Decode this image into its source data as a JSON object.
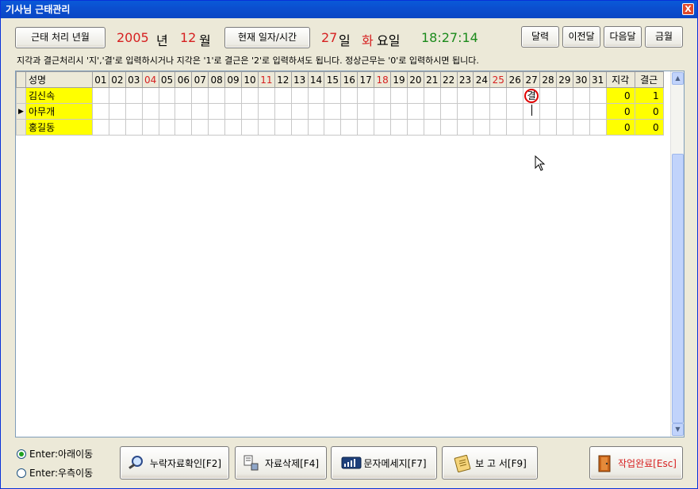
{
  "window": {
    "title": "기사님 근태관리",
    "close_glyph": "X"
  },
  "toolbar": {
    "period_button": "근태 처리 년월",
    "year": "2005",
    "year_unit": "년",
    "month": "12",
    "month_unit": "월",
    "now_button": "현재 일자/시간",
    "day": "27",
    "day_unit": "일",
    "weekday": "화",
    "weekday_unit": "요일",
    "time": "18:27:14",
    "calendar_button": "달력",
    "prev_month_button": "이전달",
    "next_month_button": "다음달",
    "this_month_button": "금월"
  },
  "instruction": "지각과 결근처리시 '지','결'로 입력하시거나 지각은 '1'로 결근은 '2'로 입력하셔도 됩니다.  정상근무는 '0'로 입력하시면 됩니다.",
  "grid": {
    "name_header": "성명",
    "day_headers": [
      "01",
      "02",
      "03",
      "04",
      "05",
      "06",
      "07",
      "08",
      "09",
      "10",
      "11",
      "12",
      "13",
      "14",
      "15",
      "16",
      "17",
      "18",
      "19",
      "20",
      "21",
      "22",
      "23",
      "24",
      "25",
      "26",
      "27",
      "28",
      "29",
      "30",
      "31"
    ],
    "red_days": [
      "04",
      "11",
      "18",
      "25"
    ],
    "late_header": "지각",
    "absent_header": "결근",
    "rows": [
      {
        "name": "김신속",
        "late": "0",
        "absent": "1",
        "marks": {
          "27": "결"
        },
        "current": false
      },
      {
        "name": "아무개",
        "late": "0",
        "absent": "0",
        "marks": {},
        "current": true
      },
      {
        "name": "홍길동",
        "late": "0",
        "absent": "0",
        "marks": {},
        "current": false
      }
    ]
  },
  "options": {
    "enter_down": "Enter:아래이동",
    "enter_right": "Enter:우측이동",
    "selected": "enter_down"
  },
  "footer": {
    "missing_check": "누락자료확인[F2]",
    "delete_data": "자료삭제[F4]",
    "sms_message": "문자메세지[F7]",
    "report": "보 고 서[F9]",
    "complete": "작업완료[Esc]"
  },
  "colors": {
    "accent_red": "#d62020",
    "time_green": "#1b8a1b",
    "highlight_yellow": "#ffff00",
    "title_blue": "#0a52d0"
  }
}
